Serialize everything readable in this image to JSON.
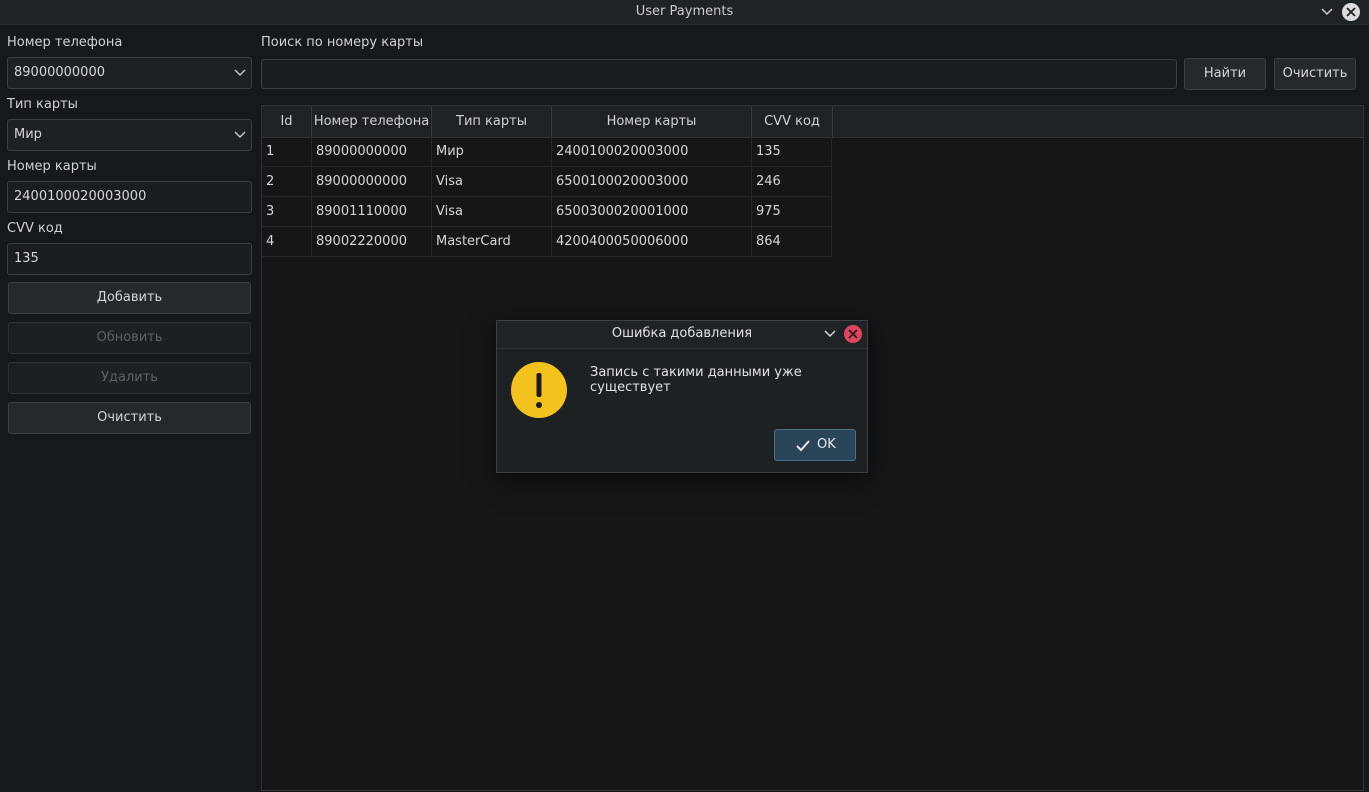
{
  "window": {
    "title": "User Payments"
  },
  "form": {
    "phone_label": "Номер телефона",
    "phone_value": "89000000000",
    "card_type_label": "Тип карты",
    "card_type_value": "Мир",
    "card_number_label": "Номер карты",
    "card_number_value": "2400100020003000",
    "cvv_label": "CVV код",
    "cvv_value": "135",
    "add_label": "Добавить",
    "update_label": "Обновить",
    "delete_label": "Удалить",
    "clear_label": "Очистить"
  },
  "search": {
    "label": "Поиск по номеру карты",
    "value": "",
    "find_label": "Найти",
    "clear_label": "Очистить"
  },
  "table": {
    "columns": [
      "Id",
      "Номер телефона",
      "Тип карты",
      "Номер карты",
      "CVV код"
    ],
    "rows": [
      [
        "1",
        "89000000000",
        "Мир",
        "2400100020003000",
        "135"
      ],
      [
        "2",
        "89000000000",
        "Visa",
        "6500100020003000",
        "246"
      ],
      [
        "3",
        "89001110000",
        "Visa",
        "6500300020001000",
        "975"
      ],
      [
        "4",
        "89002220000",
        "MasterCard",
        "4200400050006000",
        "864"
      ]
    ]
  },
  "dialog": {
    "title": "Ошибка добавления",
    "message": "Запись с такими данными уже существует",
    "ok_label": "OK"
  },
  "colors": {
    "background": "#16191c",
    "accent": "#2a4458",
    "warning": "#f4c21c",
    "close": "#e0455d"
  }
}
